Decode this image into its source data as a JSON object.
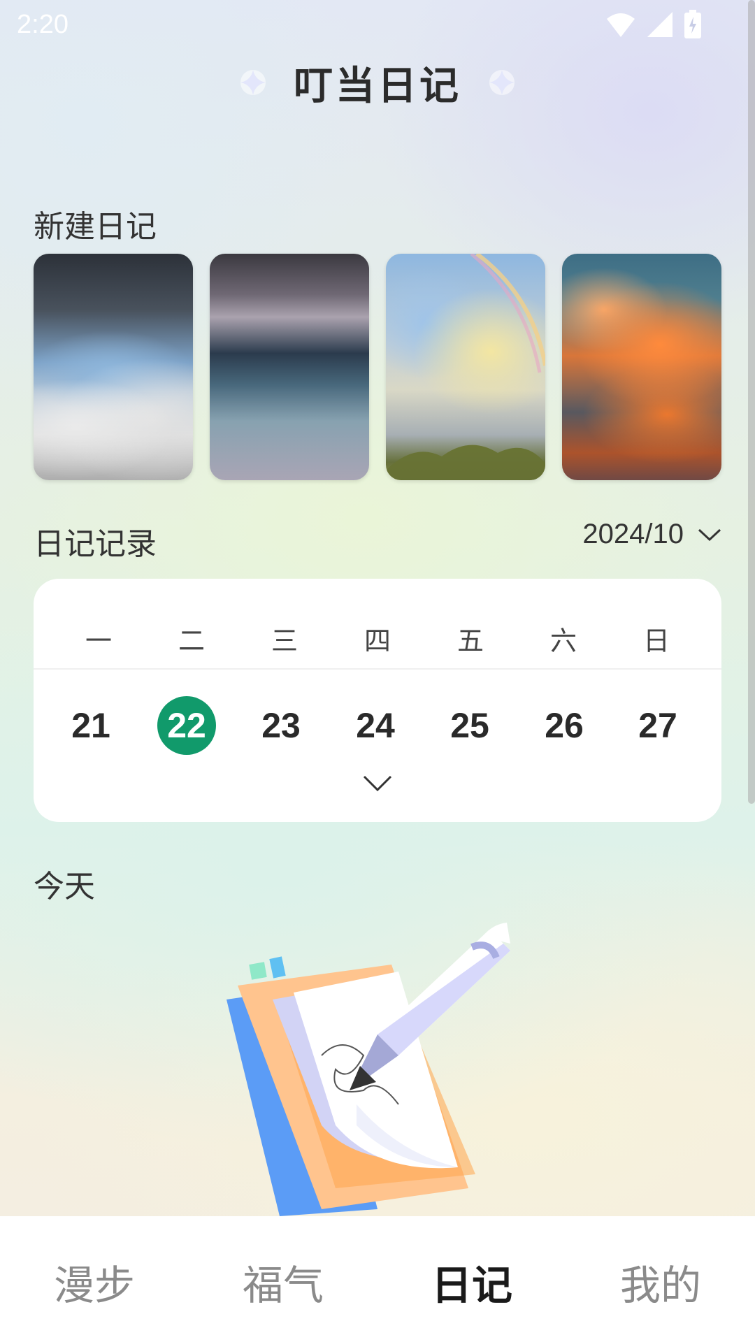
{
  "status_bar": {
    "time": "2:20"
  },
  "header": {
    "title": "叮当日记"
  },
  "new_diary": {
    "title": "新建日记",
    "templates": [
      {
        "name": "stormy-clouds"
      },
      {
        "name": "rain-water"
      },
      {
        "name": "rainbow-sky"
      },
      {
        "name": "sunset-clouds"
      }
    ]
  },
  "records": {
    "title": "日记记录",
    "month": "2024/10"
  },
  "calendar": {
    "weekdays": [
      "一",
      "二",
      "三",
      "四",
      "五",
      "六",
      "日"
    ],
    "days": [
      "21",
      "22",
      "23",
      "24",
      "25",
      "26",
      "27"
    ],
    "selected_day": "22",
    "accent_color": "#119a6b"
  },
  "today": {
    "title": "今天"
  },
  "bottom_nav": {
    "items": [
      {
        "label": "漫步"
      },
      {
        "label": "福气"
      },
      {
        "label": "日记"
      },
      {
        "label": "我的"
      }
    ],
    "active": "日记"
  }
}
